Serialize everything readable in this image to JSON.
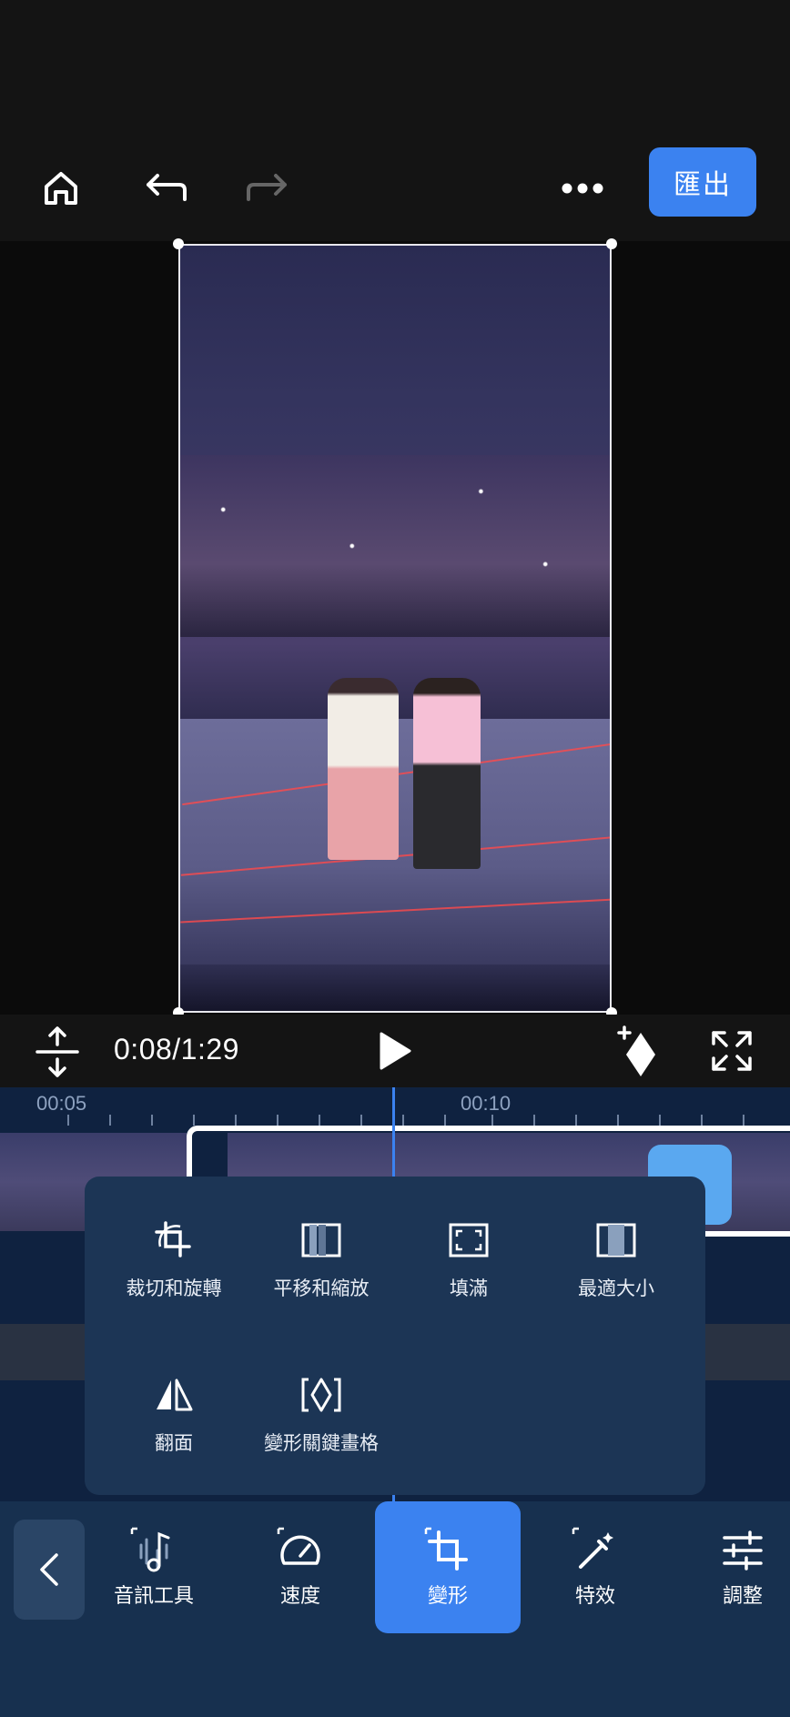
{
  "toolbar": {
    "home_icon": "home-icon",
    "undo_icon": "undo-icon",
    "redo_icon": "redo-icon",
    "more_icon": "more-icon",
    "export_label": "匯出"
  },
  "playback": {
    "time": "0:08/1:29"
  },
  "timeline": {
    "ruler": [
      "00:05",
      "00:10"
    ]
  },
  "transform_menu": {
    "items": [
      {
        "label": "裁切和旋轉",
        "icon": "crop-rotate-icon"
      },
      {
        "label": "平移和縮放",
        "icon": "pan-zoom-icon"
      },
      {
        "label": "填滿",
        "icon": "fill-icon"
      },
      {
        "label": "最適大小",
        "icon": "fit-icon"
      },
      {
        "label": "翻面",
        "icon": "flip-icon"
      },
      {
        "label": "變形關鍵畫格",
        "icon": "transform-keyframe-icon"
      }
    ]
  },
  "bottom_tools": {
    "items": [
      {
        "label": "音訊工具",
        "icon": "audio-tools-icon"
      },
      {
        "label": "速度",
        "icon": "speed-icon"
      },
      {
        "label": "變形",
        "icon": "transform-icon"
      },
      {
        "label": "特效",
        "icon": "effects-icon"
      },
      {
        "label": "調整",
        "icon": "adjust-icon"
      }
    ],
    "active_index": 2
  },
  "colors": {
    "accent": "#3b82f0",
    "panel": "#1c3555",
    "timeline_bg": "#0f2240"
  }
}
